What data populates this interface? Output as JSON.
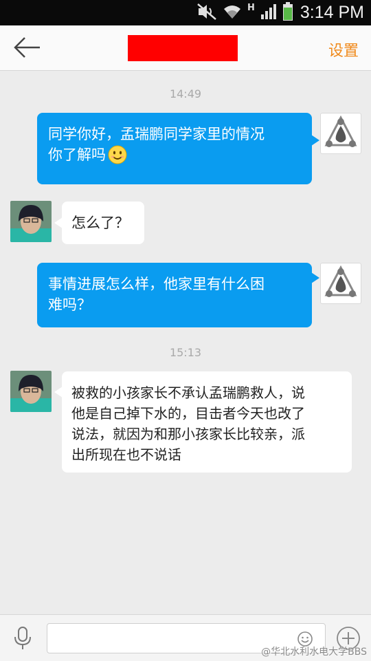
{
  "status_bar": {
    "time": "3:14 PM",
    "network_letter": "H",
    "icons": [
      "mute-icon",
      "wifi-icon",
      "signal-icon",
      "battery-icon"
    ]
  },
  "header": {
    "back_icon": "back-arrow-icon",
    "settings_label": "设置",
    "title_redacted_color": "#ff0000"
  },
  "messages": [
    {
      "type": "timestamp",
      "text": "14:49"
    },
    {
      "type": "outgoing",
      "lines": [
        "同学你好，孟瑞鹏同学家里的情况",
        "你了解吗"
      ],
      "emoji": "smile-emoji"
    },
    {
      "type": "incoming",
      "lines": [
        "怎么了？"
      ]
    },
    {
      "type": "outgoing",
      "lines": [
        "事情进展怎么样，他家里有什么困",
        "难吗？"
      ]
    },
    {
      "type": "timestamp",
      "text": "15:13"
    },
    {
      "type": "incoming",
      "lines": [
        "被救的小孩家长不承认孟瑞鹏救人，说",
        "他是自己掉下水的，目击者今天也改了",
        "说法，就因为和那小孩家长比较亲，派",
        "出所现在也不说话"
      ]
    }
  ],
  "input_bar": {
    "value": "",
    "placeholder": "",
    "icons": [
      "microphone-icon",
      "emoji-icon",
      "add-icon"
    ]
  },
  "watermark": "@华北水利水电大学BBS",
  "colors": {
    "accent_orange": "#f08a1c",
    "outgoing_bubble": "#0a9cf0",
    "incoming_bubble": "#ffffff",
    "chat_background": "#ececec"
  }
}
